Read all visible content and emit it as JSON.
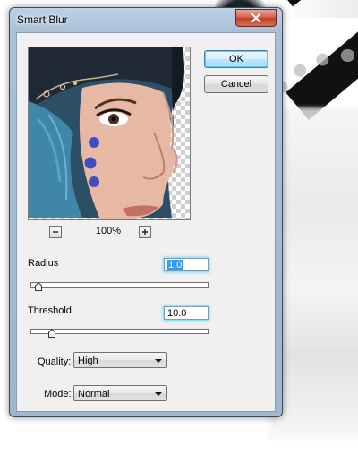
{
  "dialog": {
    "title": "Smart Blur",
    "ok_label": "OK",
    "cancel_label": "Cancel",
    "close_icon": "close-icon"
  },
  "preview": {
    "zoom_level": "100%",
    "zoom_out_icon": "minus-icon",
    "zoom_in_icon": "plus-icon"
  },
  "radius": {
    "label": "Radius",
    "value": "1.0",
    "slider_position": 0.02
  },
  "threshold": {
    "label": "Threshold",
    "value": "10.0",
    "slider_position": 0.1
  },
  "quality": {
    "label": "Quality:",
    "selected": "High"
  },
  "mode": {
    "label": "Mode:",
    "selected": "Normal"
  },
  "colors": {
    "title_bar": "#a9c0d6",
    "close_button": "#c0402a",
    "focus_glow": "#5fe0ef",
    "selection": "#3399ff"
  }
}
